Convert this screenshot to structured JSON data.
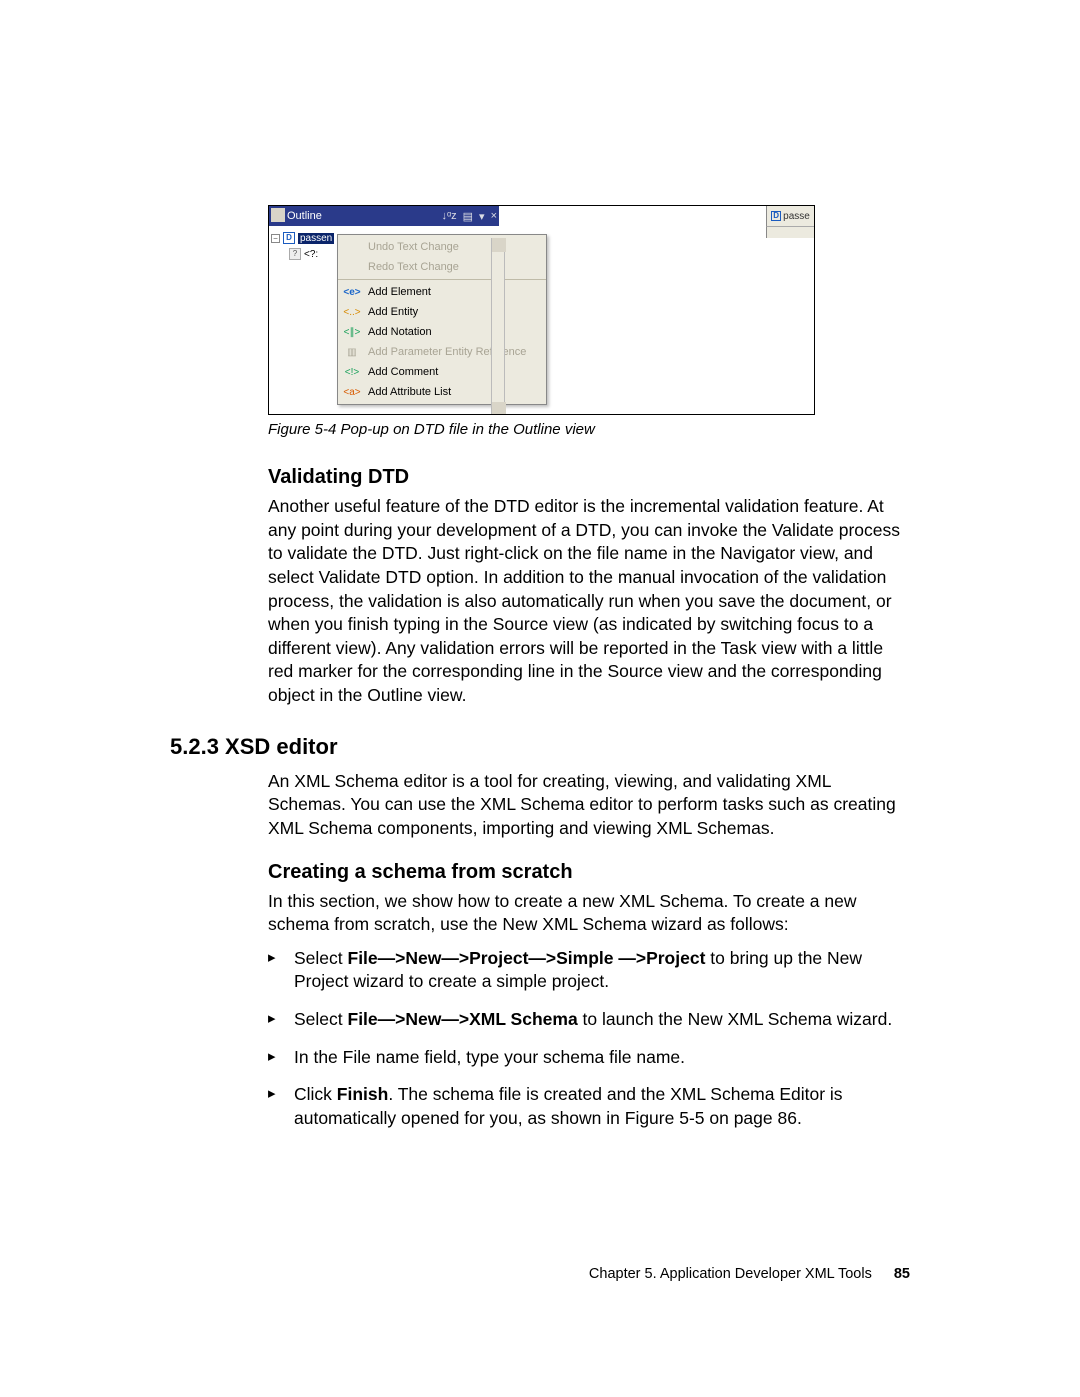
{
  "figure": {
    "outline_label": "Outline",
    "right_tab": "passe",
    "tree": {
      "root": "passen",
      "child": "<?:"
    },
    "popup": {
      "undo": "Undo Text Change",
      "redo": "Redo Text Change",
      "add_element": "Add Element",
      "add_entity": "Add Entity",
      "add_notation": "Add Notation",
      "add_param": "Add Parameter Entity Reference",
      "add_comment": "Add Comment",
      "add_attrlist": "Add Attribute List"
    },
    "caption": "Figure 5-4   Pop-up on DTD file in the Outline view"
  },
  "sec1": {
    "heading": "Validating DTD",
    "para": "Another useful feature of the DTD editor is the incremental validation feature. At any point during your development of a DTD, you can invoke the Validate process to validate the DTD. Just right-click on the file name in the Navigator view, and select Validate DTD option. In addition to the manual invocation of the validation process, the validation is also automatically run when you save the document, or when you finish typing in the Source view (as indicated by switching focus to a different view). Any validation errors will be reported in the Task view with a little red marker for the corresponding line in the Source view and the corresponding object in the Outline view."
  },
  "sec2": {
    "heading": "5.2.3  XSD editor",
    "para": "An XML Schema editor is a tool for creating, viewing, and validating XML Schemas. You can use the XML Schema editor to perform tasks such as creating XML Schema components, importing and viewing XML Schemas."
  },
  "sec3": {
    "heading": "Creating a schema from scratch",
    "intro": "In this section, we show how to create a new XML Schema. To create a new schema from scratch, use the New XML Schema wizard as follows:",
    "steps": {
      "s1a": "Select ",
      "s1b": "File—>New—>Project—>Simple —>Project",
      "s1c": " to bring up the New Project wizard to create a simple project.",
      "s2a": "Select ",
      "s2b": "File—>New—>XML Schema",
      "s2c": " to launch the New XML Schema wizard.",
      "s3": "In the File name field, type your schema file name.",
      "s4a": "Click ",
      "s4b": "Finish",
      "s4c": ". The schema file is created and the XML Schema Editor is automatically opened for you, as shown in Figure 5-5 on page 86."
    }
  },
  "footer": {
    "chapter": "Chapter 5. Application Developer XML Tools",
    "page": "85"
  }
}
